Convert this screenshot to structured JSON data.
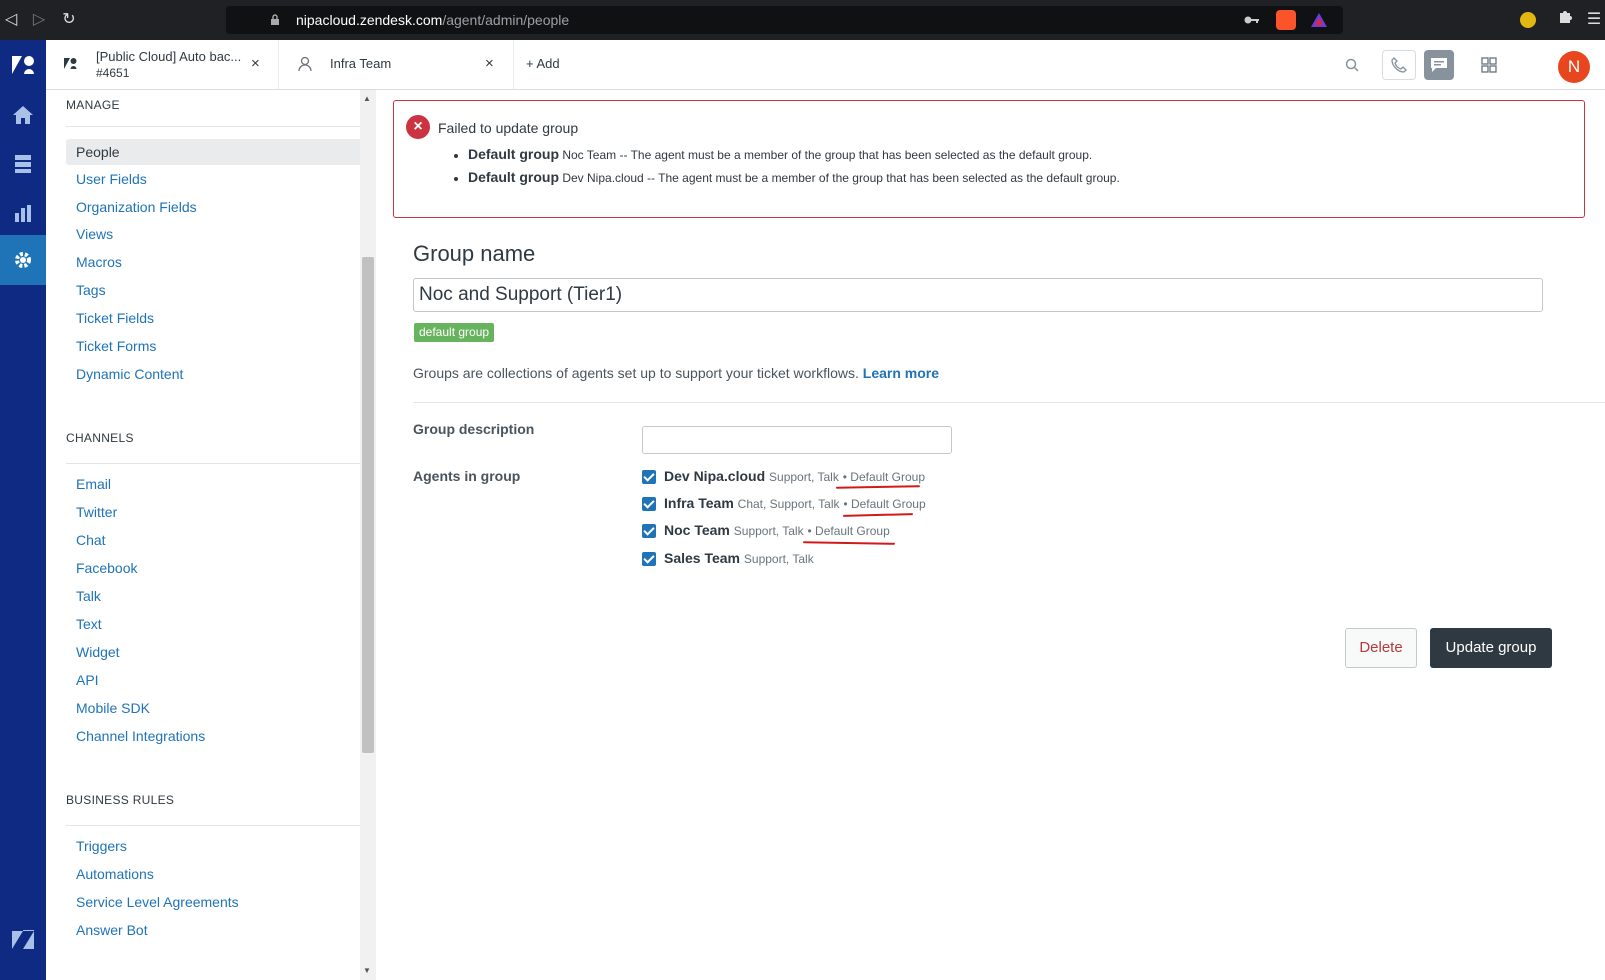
{
  "browser": {
    "url_host": "nipacloud.zendesk.com",
    "url_path": "/agent/admin/people"
  },
  "tabs": [
    {
      "title": "[Public Cloud] Auto bac...",
      "subtitle": "#4651"
    },
    {
      "title": "Infra Team"
    }
  ],
  "add_tab_label": "Add",
  "user_avatar": "N",
  "sidebar": {
    "manage": {
      "title": "MANAGE",
      "active": "People",
      "items": [
        "User Fields",
        "Organization Fields",
        "Views",
        "Macros",
        "Tags",
        "Ticket Fields",
        "Ticket Forms",
        "Dynamic Content"
      ]
    },
    "channels": {
      "title": "CHANNELS",
      "items": [
        "Email",
        "Twitter",
        "Chat",
        "Facebook",
        "Talk",
        "Text",
        "Widget",
        "API",
        "Mobile SDK",
        "Channel Integrations"
      ]
    },
    "business_rules": {
      "title": "BUSINESS RULES",
      "items": [
        "Triggers",
        "Automations",
        "Service Level Agreements",
        "Answer Bot"
      ]
    }
  },
  "error": {
    "title": "Failed to update group",
    "items": [
      {
        "label": "Default group",
        "message": "Noc Team -- The agent must be a member of the group that has been selected as the default group."
      },
      {
        "label": "Default group",
        "message": "Dev Nipa.cloud -- The agent must be a member of the group that has been selected as the default group."
      }
    ]
  },
  "form": {
    "group_name_label": "Group name",
    "group_name_value": "Noc and Support (Tier1)",
    "default_badge": "default group",
    "intro_text": "Groups are collections of agents set up to support your ticket workflows.",
    "learn_more": "Learn more",
    "description_label": "Group description",
    "description_value": "",
    "agents_label": "Agents in group",
    "agents": [
      {
        "name": "Dev Nipa.cloud",
        "roles": "Support, Talk",
        "default": "Default Group",
        "checked": true
      },
      {
        "name": "Infra Team",
        "roles": "Chat, Support, Talk",
        "default": "Default Group",
        "checked": true
      },
      {
        "name": "Noc Team",
        "roles": "Support, Talk",
        "default": "Default Group",
        "checked": true
      },
      {
        "name": "Sales Team",
        "roles": "Support, Talk",
        "default": "",
        "checked": true
      }
    ],
    "delete_label": "Delete",
    "update_label": "Update group"
  },
  "colors": {
    "nav_bg": "#0f2a82",
    "nav_active": "#1f73b7",
    "link": "#1f73b7",
    "error": "#cc3340",
    "badge": "#68b35d",
    "annotation": "#d11a1a"
  }
}
